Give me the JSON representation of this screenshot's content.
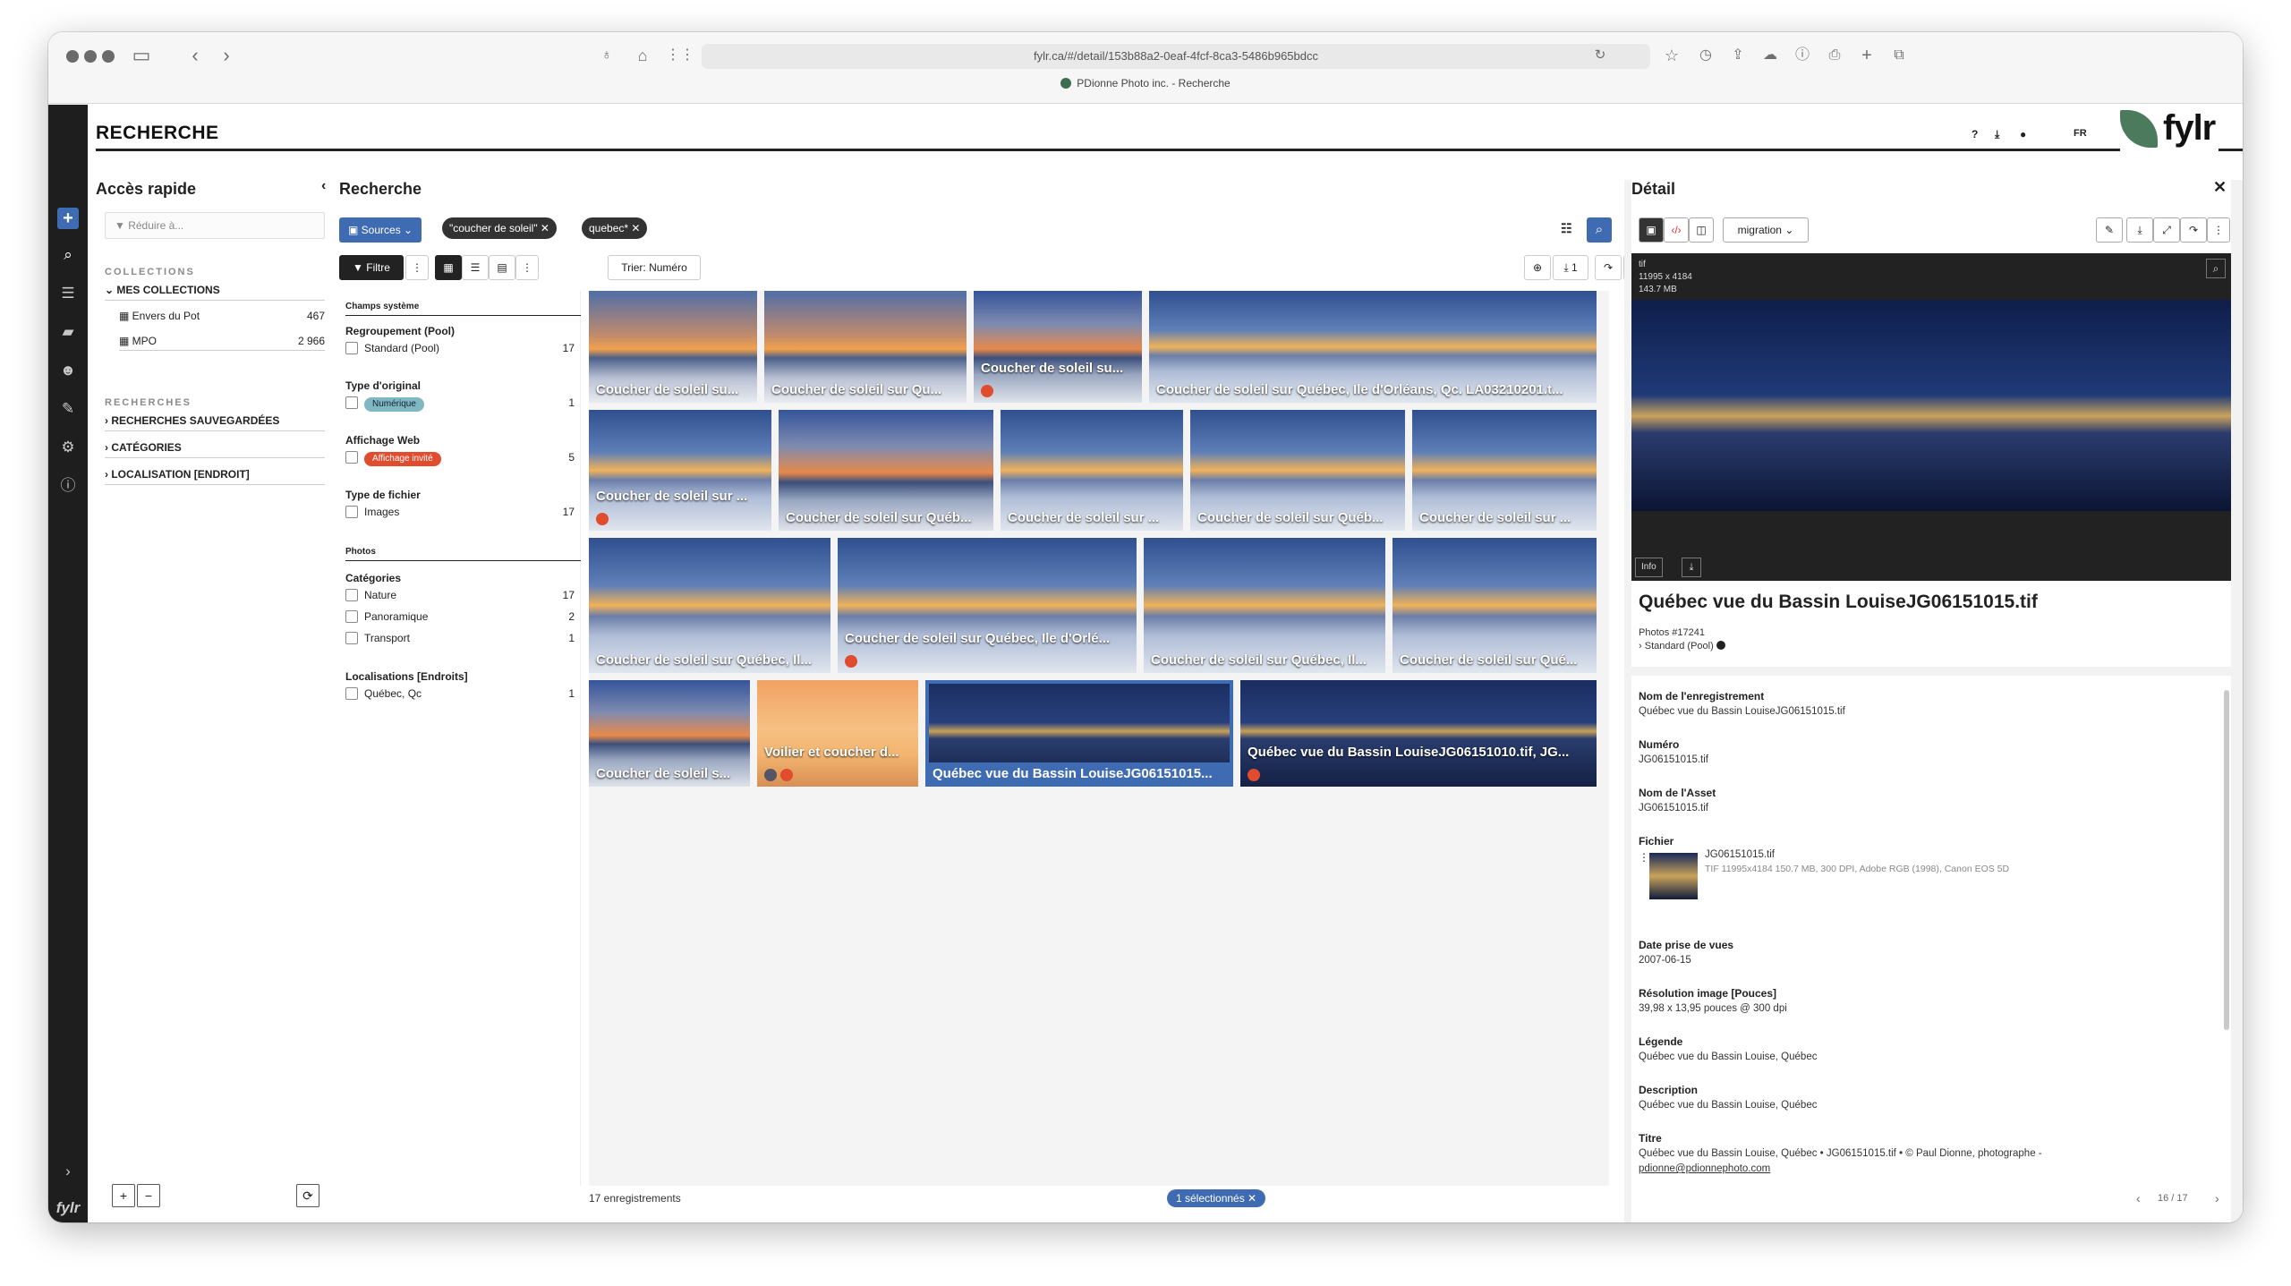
{
  "browser": {
    "url": "fylr.ca/#/detail/153b88a2-0eaf-4fcf-8ca3-5486b965bdcc",
    "tab_title": "PDionne Photo inc. - Recherche"
  },
  "header": {
    "title": "RECHERCHE",
    "help": "?",
    "lang": "FR",
    "brand": "fylr"
  },
  "rail": {
    "logo": "fylr"
  },
  "quick": {
    "title": "Accès rapide",
    "filter_placeholder": "Réduire à...",
    "collections_label": "COLLECTIONS",
    "my_collections": "MES COLLECTIONS",
    "collections": [
      {
        "label": "Envers du Pot",
        "count": "467"
      },
      {
        "label": "MPO",
        "count": "2 966"
      }
    ],
    "searches_label": "RECHERCHES",
    "saved": "RECHERCHES SAUVEGARDÉES",
    "categories": "CATÉGORIES",
    "location": "LOCALISATION [ENDROIT]"
  },
  "search": {
    "title": "Recherche",
    "sources": "Sources",
    "chips": [
      "\"coucher de soleil\"",
      "quebec*"
    ],
    "filter": "Filtre",
    "sort": "Trier: Numéro",
    "download_count": "1",
    "count": "17 enregistrements",
    "selected": "1 sélectionnés"
  },
  "facets": {
    "system": "Champs système",
    "groups": [
      {
        "title": "Regroupement (Pool)",
        "items": [
          {
            "label": "Standard (Pool)",
            "count": "17"
          }
        ]
      },
      {
        "title": "Type d'original",
        "items": [
          {
            "label": "Numérique",
            "count": "1"
          }
        ]
      },
      {
        "title": "Affichage Web",
        "items": [
          {
            "label": "Affichage invité",
            "count": "5"
          }
        ]
      },
      {
        "title": "Type de fichier",
        "items": [
          {
            "label": "Images",
            "count": "17"
          }
        ]
      }
    ],
    "photos": "Photos",
    "categories_title": "Catégories",
    "categories": [
      {
        "label": "Nature",
        "count": "17"
      },
      {
        "label": "Panoramique",
        "count": "2"
      },
      {
        "label": "Transport",
        "count": "1"
      }
    ],
    "locations_title": "Localisations [Endroits]",
    "locations": [
      {
        "label": "Québec, Qc",
        "count": "1"
      }
    ],
    "pill_colors": {
      "numerique": "#7fb7c2",
      "affichage": "#e14c2e"
    }
  },
  "grid": {
    "tiles": [
      {
        "cap": "Coucher de soleil su...",
        "style": "sunset2"
      },
      {
        "cap": "Coucher de soleil sur Qu...",
        "style": "sunset2"
      },
      {
        "cap": "Coucher de soleil su...",
        "style": "sunset"
      },
      {
        "cap": "Coucher de soleil sur Québec, Ile d'Orléans, Qc. LA03210201.t...",
        "style": "icy"
      },
      {
        "cap": "Coucher de soleil sur ...",
        "style": "icy"
      },
      {
        "cap": "Coucher de soleil sur Québ...",
        "style": "sunset"
      },
      {
        "cap": "Coucher de soleil sur ...",
        "style": "icy"
      },
      {
        "cap": "Coucher de soleil sur Québ...",
        "style": "icy"
      },
      {
        "cap": "Coucher de soleil sur ...",
        "style": "icy"
      },
      {
        "cap": "Coucher de soleil sur Québec, Il...",
        "style": "icy"
      },
      {
        "cap": "Coucher de soleil sur Québec, Ile d'Orlé...",
        "style": "icy"
      },
      {
        "cap": "Coucher de soleil sur Québec, Il...",
        "style": "icy"
      },
      {
        "cap": "Coucher de soleil sur Qué...",
        "style": "icy"
      },
      {
        "cap": "Coucher de soleil s...",
        "style": "sunset"
      },
      {
        "cap": "Voilier et coucher d...",
        "style": "orange"
      },
      {
        "cap": "Québec vue du Bassin LouiseJG06151015...",
        "style": "night"
      },
      {
        "cap": "Québec vue du Bassin LouiseJG06151010.tif, JG...",
        "style": "night"
      }
    ]
  },
  "detail": {
    "title": "Détail",
    "migration": "migration",
    "ext": "tif",
    "dims": "11995 x 4184",
    "size": "143.7 MB",
    "info": "Info",
    "name": "Québec vue du Bassin LouiseJG06151015.tif",
    "pool_id": "Photos #17241",
    "pool": "Standard (Pool)",
    "fields": [
      {
        "label": "Nom de l'enregistrement",
        "value": "Québec vue du Bassin LouiseJG06151015.tif"
      },
      {
        "label": "Numéro",
        "value": "JG06151015.tif"
      },
      {
        "label": "Nom de l'Asset",
        "value": "JG06151015.tif"
      },
      {
        "label": "Fichier",
        "value": ""
      },
      {
        "label": "Date prise de vues",
        "value": "2007-06-15"
      },
      {
        "label": "Résolution image [Pouces]",
        "value": "39,98 x 13,95 pouces @ 300 dpi"
      },
      {
        "label": "Légende",
        "value": "Québec vue du Bassin Louise, Québec"
      },
      {
        "label": "Description",
        "value": "Québec vue du Bassin Louise, Québec"
      },
      {
        "label": "Titre",
        "value": "Québec vue du Bassin Louise, Québec • JG06151015.tif • © Paul Dionne, photographe -"
      }
    ],
    "file_name": "JG06151015.tif",
    "file_meta": "TIF 11995x4184 150.7 MB, 300 DPI, Adobe RGB (1998), Canon EOS 5D",
    "email": "pdionne@pdionnephoto.com",
    "pager": "16 / 17"
  }
}
